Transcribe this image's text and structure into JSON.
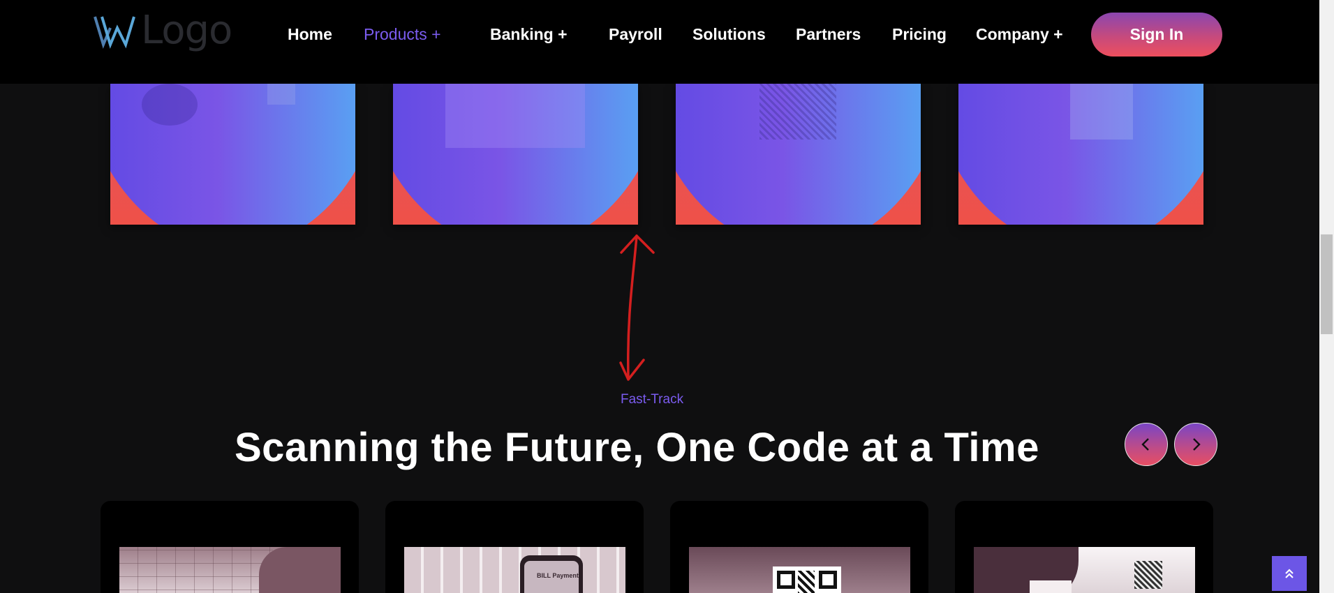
{
  "header": {
    "logo_text": "Logo",
    "nav": [
      {
        "label": "Home"
      },
      {
        "label": "Products +"
      },
      {
        "label": "Banking +"
      },
      {
        "label": "Payroll"
      },
      {
        "label": "Solutions"
      },
      {
        "label": "Partners"
      },
      {
        "label": "Pricing"
      },
      {
        "label": "Company +"
      }
    ],
    "active_nav": "Products +",
    "signin_label": "Sign In"
  },
  "section": {
    "eyebrow": "Fast-Track",
    "headline": "Scanning the Future, One Code at a Time"
  },
  "bottom_cards": [
    {
      "image": "calendar-photo"
    },
    {
      "image": "bill-payment-phone-photo",
      "caption": "BILL Payment"
    },
    {
      "image": "qr-code-photo"
    },
    {
      "image": "qr-card-photo"
    }
  ],
  "colors": {
    "accent": "#7b5cf0",
    "gradient_red": "#ef5148",
    "gradient_blue": "#52b0f5",
    "annotation_red": "#d41f1f"
  },
  "icons": {
    "prev": "chevron-left-icon",
    "next": "chevron-right-icon",
    "to_top": "double-chevron-up-icon"
  }
}
